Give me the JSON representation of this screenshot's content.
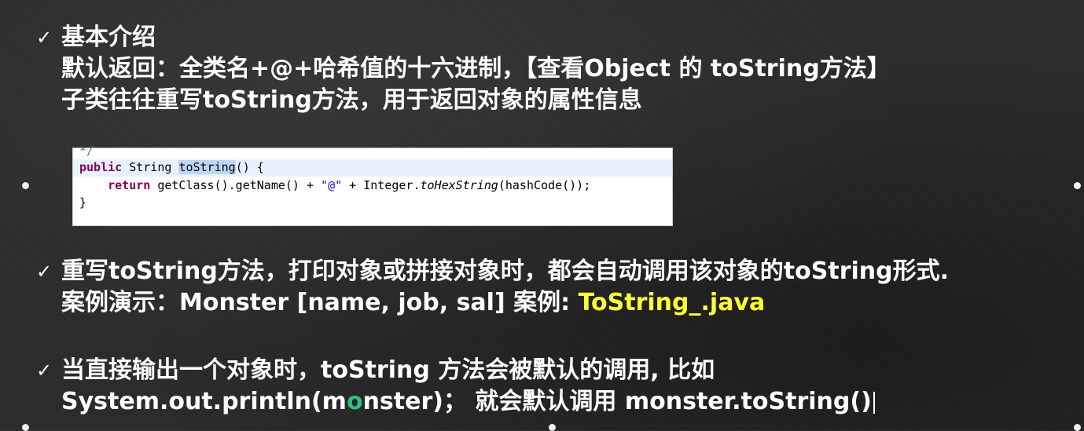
{
  "slide": {
    "bullet1": {
      "line1": "基本介绍",
      "line2": "默认返回：全类名+@+哈希值的十六进制，【查看Object 的 toString方法】",
      "line3": "子类往往重写toString方法，用于返回对象的属性信息"
    },
    "code": {
      "line0": "*/",
      "line1_kw": "public",
      "line1_type": " String ",
      "line1_name": "toString",
      "line1_rest": "() {",
      "line2_kw": "    return",
      "line2_a": " getClass().getName() + ",
      "line2_str": "\"@\"",
      "line2_b": " + Integer.",
      "line2_it": "toHexString",
      "line2_c": "(hashCode());",
      "line3": "}"
    },
    "bullet2": {
      "line1": "重写toString方法，打印对象或拼接对象时，都会自动调用该对象的toString形式.",
      "line2_prefix": "案例演示：Monster [name, job, sal]  案例: ",
      "line2_highlight": "ToString_.java"
    },
    "bullet3": {
      "line1": "当直接输出一个对象时，toString 方法会被默认的调用, 比如",
      "line2_a": "System.out.println(m",
      "line2_o": "o",
      "line2_b": "nster)；  就会默认调用 monster.toString()"
    },
    "check_symbol": "✓",
    "colors": {
      "background": "#2b2b2b",
      "text": "#ffffff",
      "highlight": "#ffff33"
    }
  }
}
